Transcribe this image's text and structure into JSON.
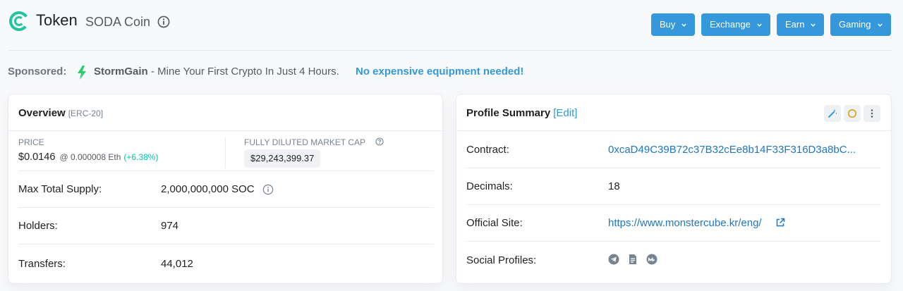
{
  "header": {
    "title": "Token",
    "subtitle": "SODA Coin",
    "buttons": [
      {
        "label": "Buy"
      },
      {
        "label": "Exchange"
      },
      {
        "label": "Earn"
      },
      {
        "label": "Gaming"
      }
    ]
  },
  "sponsored": {
    "label": "Sponsored:",
    "name": "StormGain",
    "text": "- Mine Your First Crypto In Just 4 Hours.",
    "link": "No expensive equipment needed!"
  },
  "overview": {
    "title": "Overview",
    "tag": "[ERC-20]",
    "price_label": "PRICE",
    "price": "$0.0146",
    "price_eth": "@ 0.000008 Eth",
    "price_change": "(+6.38%)",
    "mcap_label": "FULLY DILUTED MARKET CAP",
    "mcap_value": "$29,243,399.37",
    "rows": [
      {
        "label": "Max Total Supply:",
        "value": "2,000,000,000 SOC"
      },
      {
        "label": "Holders:",
        "value": "974"
      },
      {
        "label": "Transfers:",
        "value": "44,012"
      }
    ]
  },
  "profile": {
    "title": "Profile Summary",
    "edit": "[Edit]",
    "rows": [
      {
        "label": "Contract:",
        "value": "0xcaD49C39B72c37B32cEe8b14F33F316D3a8bC..."
      },
      {
        "label": "Decimals:",
        "value": "18"
      },
      {
        "label": "Official Site:",
        "value": "https://www.monstercube.kr/eng/"
      },
      {
        "label": "Social Profiles:",
        "value": ""
      }
    ],
    "social_icons": [
      "telegram-icon",
      "document-icon",
      "coinmarketcap-icon"
    ]
  },
  "colors": {
    "primary": "#3498db",
    "success": "#00c9a7",
    "link": "#1e77c0",
    "logo": "#21c5a0"
  }
}
